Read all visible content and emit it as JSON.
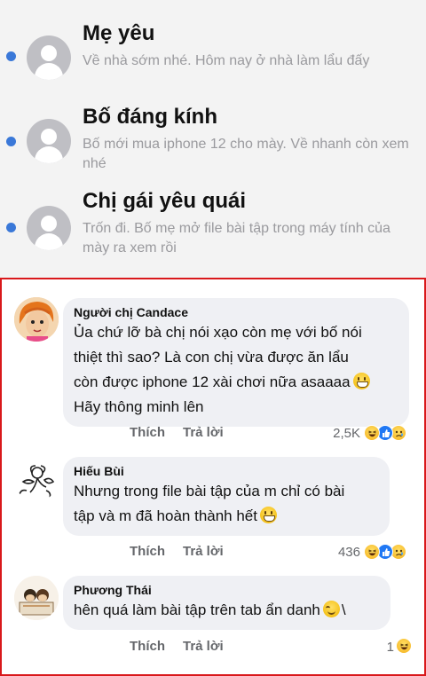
{
  "messages": [
    {
      "name": "Mẹ yêu",
      "preview": "Về nhà sớm nhé. Hôm nay ở nhà làm lẩu đấy"
    },
    {
      "name": "Bố đáng kính",
      "preview": "Bố mới mua iphone 12 cho mày. Về nhanh còn xem nhé"
    },
    {
      "name": "Chị gái yêu quái",
      "preview": "Trốn đi. Bố mẹ mở file bài tập trong máy tính của mày ra xem rồi"
    }
  ],
  "comments": [
    {
      "author": "Người chị Candace",
      "lines": [
        "Ủa chứ lỡ bà chị nói xạo còn mẹ với bố nói",
        "thiệt thì sao? Là con chị vừa được ăn lẩu",
        "còn được iphone 12 xài chơi nữa asaaaa",
        "Hãy thông minh lên"
      ],
      "like_label": "Thích",
      "reply_label": "Trả lời",
      "reaction_count": "2,5K",
      "reactions": [
        "haha-icon",
        "like-icon",
        "sad-icon"
      ]
    },
    {
      "author": "Hiếu Bùi",
      "lines": [
        "Nhưng trong file bài tập của m chỉ có bài",
        "tập và m đã hoàn thành hết"
      ],
      "like_label": "Thích",
      "reply_label": "Trả lời",
      "reaction_count": "436",
      "reactions": [
        "haha-icon",
        "like-icon",
        "sad-icon"
      ]
    },
    {
      "author": "Phương Thái",
      "lines": [
        "hên quá làm bài tập trên tab ẩn danh"
      ],
      "like_label": "Thích",
      "reply_label": "Trả lời",
      "reaction_count": "1",
      "reactions": [
        "haha-icon"
      ]
    }
  ],
  "colors": {
    "unread_dot": "#3a78d8",
    "border_red": "#d9181b",
    "bubble": "#eff0f4",
    "like_blue": "#2078f4"
  }
}
